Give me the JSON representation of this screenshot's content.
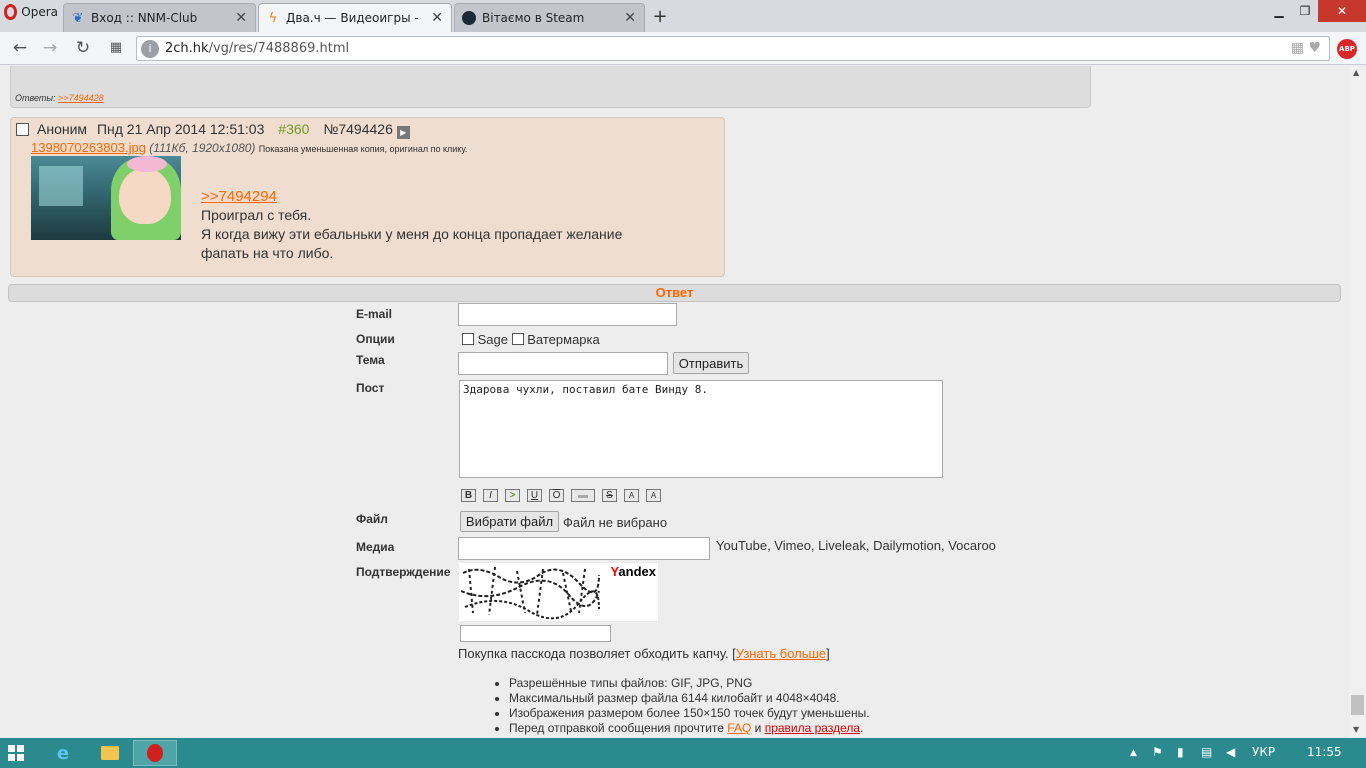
{
  "browser": {
    "menu_label": "Opera",
    "tabs": [
      {
        "title": "Вход :: NNM-Club",
        "active": false
      },
      {
        "title": "Два.ч — Видеоигры -",
        "active": true
      },
      {
        "title": "Вітаємо в Steam",
        "active": false
      }
    ],
    "url_host": "2ch.hk",
    "url_path": "/vg/res/7488869.html",
    "adblock_label": "ABP"
  },
  "prev_post": {
    "replies_label": "Ответы:",
    "reply_link": ">>7494428"
  },
  "post": {
    "author": "Аноним",
    "date": "Пнд 21 Апр 2014 12:51:03",
    "index": "#360",
    "number": "№7494426",
    "file_name": "1398070263803.jpg",
    "file_meta": "(111Кб, 1920x1080)",
    "file_note": "Показана уменьшенная копия, оригинал по клику.",
    "reply_link": ">>7494294",
    "lines": [
      "Проиграл с тебя.",
      "Я когда вижу эти ебальньки у меня до конца пропадает желание",
      "фапать на что либо."
    ]
  },
  "form": {
    "title": "Ответ",
    "email_label": "E-mail",
    "options_label": "Опции",
    "sage_label": "Sage",
    "watermark_label": "Ватермарка",
    "subject_label": "Тема",
    "submit_label": "Отправить",
    "post_label": "Пост",
    "post_text": "Здарова чухли, поставил бате Винду 8.",
    "format_buttons": [
      "B",
      "I",
      ">",
      "U",
      "O",
      "▬",
      "S",
      "A",
      "A"
    ],
    "file_label": "Файл",
    "file_button": "Вибрати файл",
    "file_status": "Файл не вибрано",
    "media_label": "Медиа",
    "media_services": "YouTube, Vimeo, Liveleak, Dailymotion, Vocaroo",
    "captcha_label": "Подтверждение",
    "captcha_brand": "Yandex",
    "passcode_text": "Покупка пасскода позволяет обходить капчу. [",
    "passcode_link": "Узнать больше",
    "passcode_close": "]",
    "rules": [
      "Разрешённые типы файлов: GIF, JPG, PNG",
      "Максимальный размер файла 6144 килобайт и 4048×4048.",
      "Изображения размером более 150×150 точек будут уменьшены."
    ],
    "rule_last_prefix": "Перед отправкой сообщения прочтите",
    "rule_last_faq": "FAQ",
    "rule_last_and": "и",
    "rule_last_rules": "правила раздела",
    "rule_last_suffix": "."
  },
  "taskbar": {
    "language": "УКР",
    "time": "11:55"
  },
  "colors": {
    "accent": "#ff6600",
    "post_bg": "#efddd0",
    "taskbar": "#2a8a8e"
  }
}
